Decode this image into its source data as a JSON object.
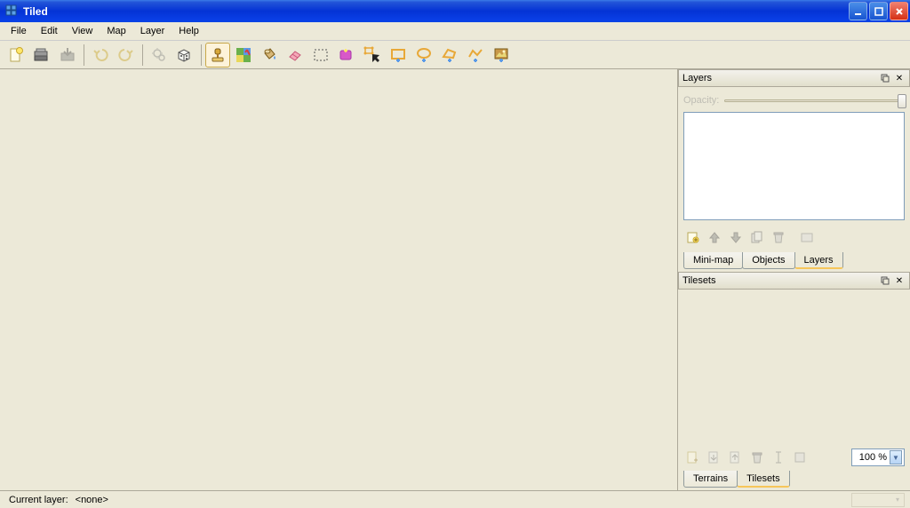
{
  "window": {
    "title": "Tiled"
  },
  "menu": {
    "items": [
      "File",
      "Edit",
      "View",
      "Map",
      "Layer",
      "Help"
    ]
  },
  "toolbar": {
    "groups": [
      [
        {
          "name": "new-icon",
          "kind": "new"
        },
        {
          "name": "open-icon",
          "kind": "open"
        },
        {
          "name": "save-icon",
          "kind": "save",
          "disabled": true
        }
      ],
      [
        {
          "name": "undo-icon",
          "kind": "undo",
          "disabled": true
        },
        {
          "name": "redo-icon",
          "kind": "redo",
          "disabled": true
        }
      ],
      [
        {
          "name": "command-icon",
          "kind": "gear",
          "disabled": true
        },
        {
          "name": "random-icon",
          "kind": "dice"
        }
      ],
      [
        {
          "name": "stamp-brush-icon",
          "kind": "stamp",
          "active": true
        },
        {
          "name": "terrain-brush-icon",
          "kind": "terrain"
        },
        {
          "name": "bucket-fill-icon",
          "kind": "bucket"
        },
        {
          "name": "eraser-icon",
          "kind": "eraser"
        },
        {
          "name": "rect-select-icon",
          "kind": "rectselect"
        },
        {
          "name": "magic-wand-icon",
          "kind": "wand"
        },
        {
          "name": "select-object-icon",
          "kind": "pointer"
        },
        {
          "name": "insert-rectangle-icon",
          "kind": "rectobj"
        },
        {
          "name": "insert-ellipse-icon",
          "kind": "ellipse"
        },
        {
          "name": "insert-polygon-icon",
          "kind": "polygon"
        },
        {
          "name": "insert-polyline-icon",
          "kind": "polyline"
        },
        {
          "name": "insert-image-icon",
          "kind": "image"
        }
      ]
    ]
  },
  "layers_panel": {
    "title": "Layers",
    "opacity_label": "Opacity:",
    "tools": [
      "new-layer",
      "move-up",
      "move-down",
      "duplicate",
      "delete",
      "show-hide"
    ],
    "tabs": [
      "Mini-map",
      "Objects",
      "Layers"
    ],
    "active_tab": 2
  },
  "tilesets_panel": {
    "title": "Tilesets",
    "tools": [
      "new-tileset",
      "import",
      "export",
      "delete",
      "rename",
      "properties"
    ],
    "zoom": "100 %",
    "tabs": [
      "Terrains",
      "Tilesets"
    ],
    "active_tab": 1
  },
  "statusbar": {
    "current_layer_label": "Current layer:",
    "current_layer_value": "<none>"
  }
}
